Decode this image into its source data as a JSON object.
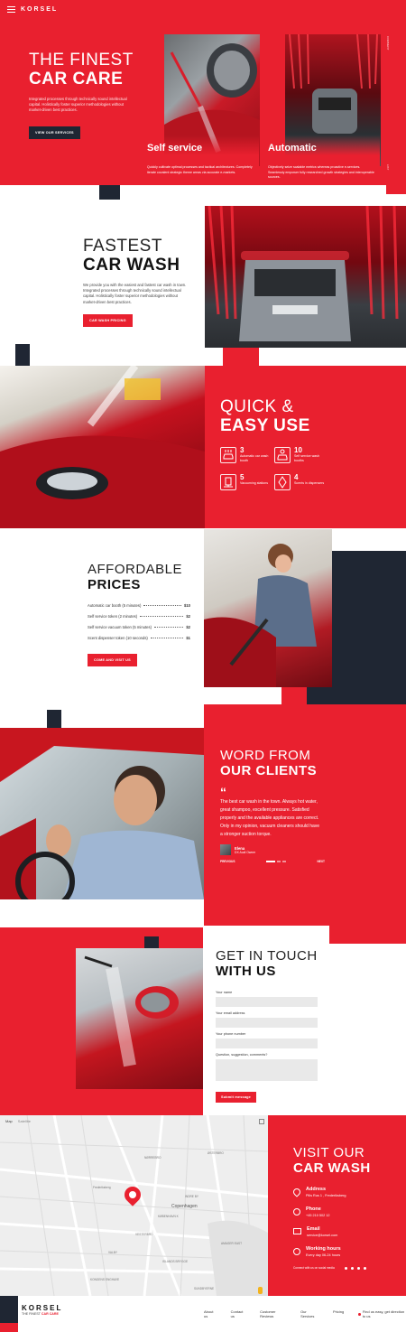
{
  "header": {
    "brand": "KORSEL"
  },
  "hero": {
    "title_light": "THE FINEST",
    "title_bold": "CAR CARE",
    "text": "Integrated processes through technically sound intellectual capital. Holistically foster superior methodologies without market-driven best practices.",
    "cta": "VIEW OUR SERVICES",
    "card1_title": "Self service",
    "card1_text": "Quickly cultivate optimal processes and tactical architectures. Completely iterate covalent strategic theme areas via accurate e-markets.",
    "card2_title": "Automatic",
    "card2_text": "Objectively seize scalable metrics whereas proactive e-services. Seamlessly empower fully researched growth strategies and interoperable sources.",
    "side_text_top": "COMMENT",
    "side_text_bottom": "LIST"
  },
  "fastest": {
    "title_light": "FASTEST",
    "title_bold": "CAR WASH",
    "text": "We provide you with the easiest and fastest car wash in town. Integrated processes through technically sound intellectual capital. Holistically foster superior methodologies without market-driven best practices.",
    "cta": "CAR WASH PRICING"
  },
  "quick": {
    "title_light": "QUICK &",
    "title_bold": "EASY USE",
    "features": [
      {
        "icon": "car-wash-icon",
        "num": "3",
        "cap": "Automatic car wash booth"
      },
      {
        "icon": "spray-booth-icon",
        "num": "10",
        "cap": "Self service wash booths"
      },
      {
        "icon": "vacuum-icon",
        "num": "5",
        "cap": "Vacuuming stations"
      },
      {
        "icon": "scent-icon",
        "num": "4",
        "cap": "Scents in dispensers"
      }
    ]
  },
  "prices": {
    "title_light": "AFFORDABLE",
    "title_bold": "PRICES",
    "items": [
      {
        "label": "Automatic car booth (5 minutes)",
        "value": "$10"
      },
      {
        "label": "Self service token (2 minutes)",
        "value": "$2"
      },
      {
        "label": "Self service vacuum token (5 minutes)",
        "value": "$2"
      },
      {
        "label": "Scent dispenser token (10 seconds)",
        "value": "$1"
      }
    ],
    "cta": "COME AND VISIT US"
  },
  "clients": {
    "title_light": "WORD FROM",
    "title_bold": "OUR CLIENTS",
    "quote_mark": "“",
    "quote": "The best car wash in the town. Always hot water, great shampoo, excellent pressure. Satisfied properly and the available appliances are correct. Only in my opinion, vacuum cleaners should have a stronger suction torque.",
    "author": "Elena",
    "author_role": "DX Audi Owner",
    "prev": "PREVIOUS",
    "next": "NEXT"
  },
  "contact": {
    "title_light": "GET IN TOUCH",
    "title_bold": "WITH US",
    "name_label": "Your name",
    "email_label": "Your email address",
    "phone_label": "Your phone number",
    "comments_label": "Question, suggestion, comments?",
    "submit": "Submit message"
  },
  "visit": {
    "title_light": "VISIT OUR",
    "title_bold": "CAR WASH",
    "address_title": "Address",
    "address": "Pilis Rus 1 , Frederiksberg",
    "phone_title": "Phone",
    "phone": "+45 210 502 12",
    "email_title": "Email",
    "email": "service@korsel.com",
    "hours_title": "Working hours",
    "hours": "Every day 06-24 hours",
    "social_text": "Connect with us on social media"
  },
  "map": {
    "tab_map": "Map",
    "tab_satellite": "Satellite",
    "city": "Copenhagen",
    "labels": [
      "Frederiksberg",
      "KØBENHAVN K",
      "VESTERBRO",
      "ISLANDS BRYGGE",
      "AMAGER EAST",
      "VALBY",
      "INDRE BY",
      "NØRREBRO",
      "ØSTERBRO",
      "KONGENS ENGHAVE",
      "SUNDBYERNE"
    ]
  },
  "footer": {
    "brand": "KORSEL",
    "tag_light": "THE FINEST",
    "tag_bold": "CAR CARE",
    "links": [
      "About us",
      "Contact us",
      "Customer Reviews",
      "Our Services",
      "Pricing"
    ],
    "directions": "Find us easy, get direction to us"
  },
  "colors": {
    "accent": "#e9202f",
    "navy": "#1f2633"
  }
}
